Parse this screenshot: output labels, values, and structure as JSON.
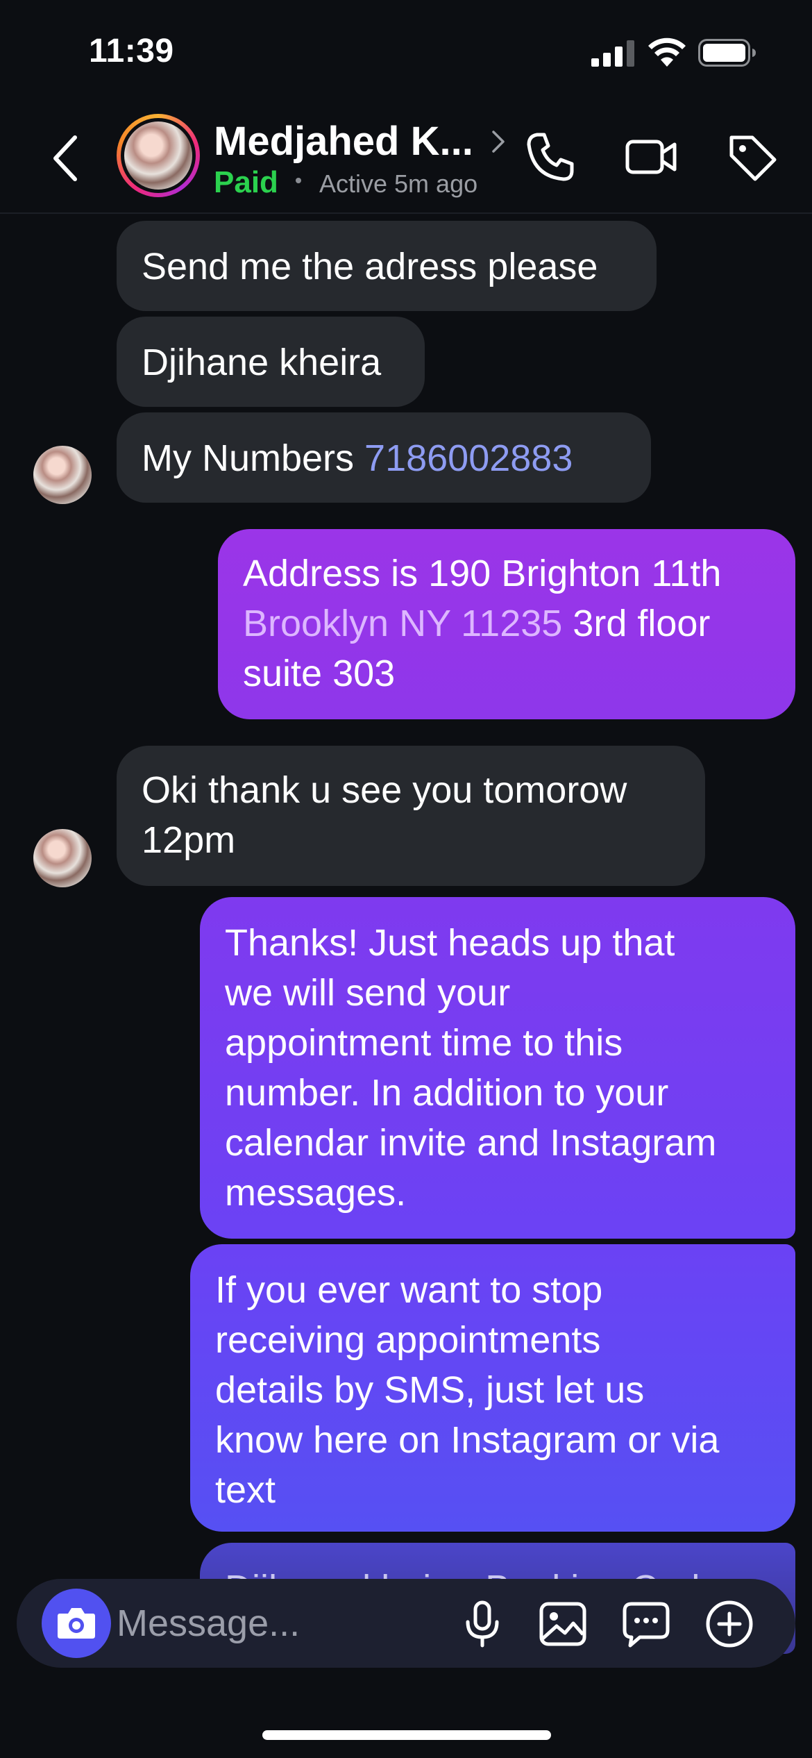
{
  "status_bar": {
    "time": "11:39"
  },
  "header": {
    "contact_name": "Medjahed K...",
    "label": "Paid",
    "active_status": "Active 5m ago",
    "icons": [
      "back-icon",
      "phone-icon",
      "video-icon",
      "tag-icon"
    ]
  },
  "messages": [
    {
      "dir": "in",
      "text": "Send me the adress please"
    },
    {
      "dir": "in",
      "text": "Djihane kheira"
    },
    {
      "dir": "in",
      "text_prefix": "My Numbers ",
      "link": "7186002883"
    },
    {
      "dir": "out",
      "line1": "Address is 190 Brighton 11th",
      "link": "Brooklyn NY 11235",
      "line2_rest": " 3rd floor",
      "line3": "suite 303"
    },
    {
      "dir": "in",
      "lines": [
        "Oki thank u see you tomorow",
        "12pm"
      ]
    },
    {
      "dir": "out",
      "lines": [
        "Thanks! Just heads up that",
        "we will send your",
        "appointment time to this",
        "number. In addition to your",
        "calendar invite and Instagram",
        "messages."
      ]
    },
    {
      "dir": "out",
      "lines": [
        "If you ever want to stop",
        "receiving appointments",
        "details by SMS, just let us",
        "know here on Instagram or via",
        "text"
      ]
    },
    {
      "dir": "out",
      "partial_text": "Djihane kheira, Booking Code"
    }
  ],
  "composer": {
    "placeholder": "Message...",
    "icons": [
      "camera-icon",
      "microphone-icon",
      "gallery-icon",
      "sticker-icon",
      "plus-icon"
    ]
  },
  "colors": {
    "background": "#0c0e12",
    "incoming_bubble": "#26292e",
    "outgoing_gradient_top": "#9b35e8",
    "outgoing_gradient_bottom": "#5651f2",
    "paid_label": "#2bd14e",
    "link": "#8e9cf2",
    "camera_button": "#5151f0"
  }
}
